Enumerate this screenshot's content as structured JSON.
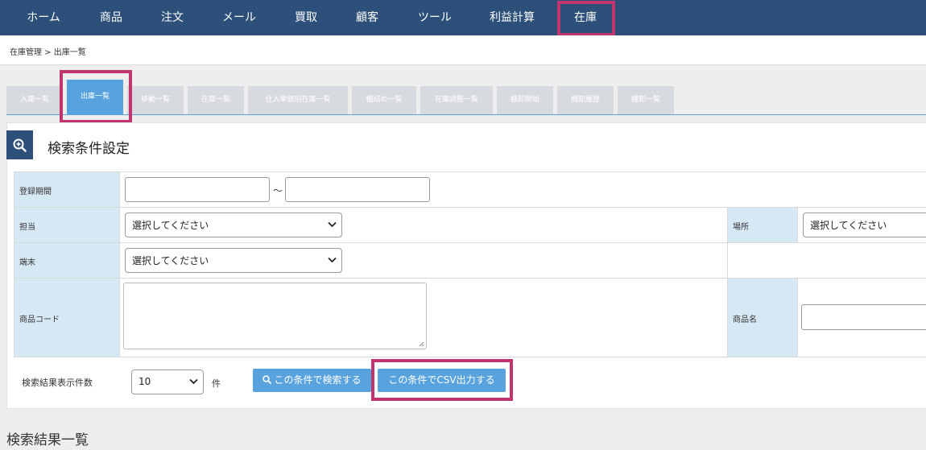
{
  "nav": {
    "items": [
      "ホーム",
      "商品",
      "注文",
      "メール",
      "買取",
      "顧客",
      "ツール",
      "利益計算",
      "在庫"
    ]
  },
  "breadcrumb": "在庫管理 > 出庫一覧",
  "tabs": [
    "入庫一覧",
    "出庫一覧",
    "移動一覧",
    "在庫一覧",
    "仕入単価別在庫一覧",
    "棚詰め一覧",
    "在庫調整一覧",
    "棚卸開始",
    "棚卸履歴",
    "棚卸一覧"
  ],
  "panel": {
    "title": "検索条件設定",
    "labels": {
      "period": "登録期間",
      "tilde": "〜",
      "staff": "担当",
      "location": "場所",
      "terminal": "端末",
      "product_code": "商品コード",
      "product_name": "商品名",
      "results_count": "検索結果表示件数",
      "unit": "件"
    },
    "select_placeholder": "選択してください",
    "count_value": "10",
    "buttons": {
      "search": "この条件で検索する",
      "csv": "この条件でCSV出力する"
    }
  },
  "results_title": "検索結果一覧",
  "colors": {
    "nav_bg": "#2c5079",
    "accent": "#58a3dd",
    "highlight": "#c0356e",
    "label_bg": "#d7e8f5"
  }
}
